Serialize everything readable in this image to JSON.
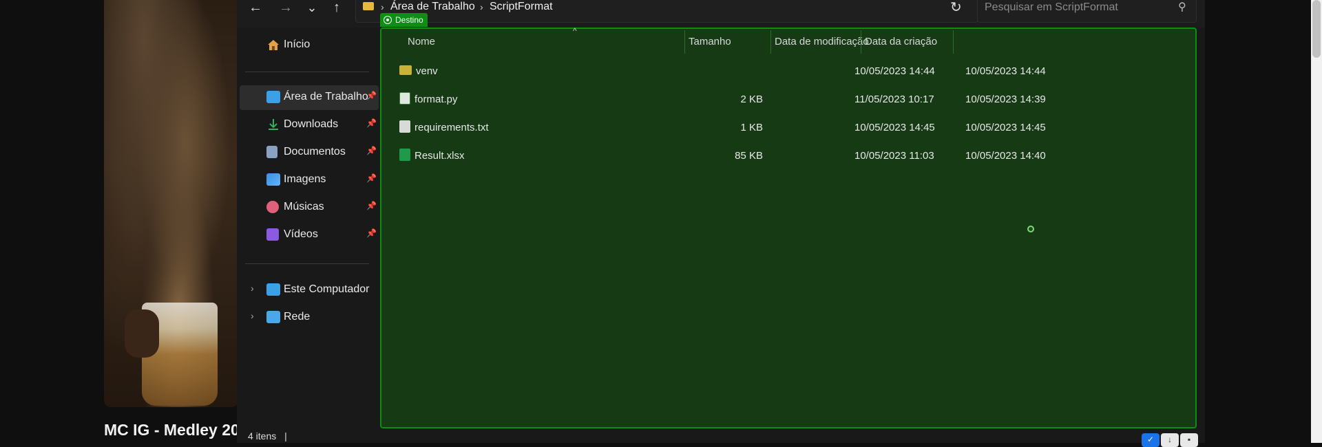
{
  "background_page": {
    "video_title": "MC IG - Medley 20"
  },
  "navbar": {
    "back_glyph": "←",
    "forward_glyph": "→",
    "recent_glyph": "⌄",
    "up_glyph": "↑",
    "breadcrumb": [
      "Área de Trabalho",
      "ScriptFormat"
    ],
    "breadcrumb_sep": "›",
    "dropdown_glyph": "⌄",
    "refresh_glyph": "↻",
    "search_placeholder": "Pesquisar em ScriptFormat",
    "search_glyph": "⚲"
  },
  "sidebar": {
    "home": "Início",
    "pinned": [
      {
        "label": "Área de Trabalho",
        "icon": "desktop-icon",
        "color": "#3ba0e6"
      },
      {
        "label": "Downloads",
        "icon": "download-icon",
        "color": "#2fb35a"
      },
      {
        "label": "Documentos",
        "icon": "documents-icon",
        "color": "#8aa2c2"
      },
      {
        "label": "Imagens",
        "icon": "pictures-icon",
        "color": "#3b8fe0"
      },
      {
        "label": "Músicas",
        "icon": "music-icon",
        "color": "#e0607a"
      },
      {
        "label": "Vídeos",
        "icon": "videos-icon",
        "color": "#8a5ae0"
      }
    ],
    "pin_glyph": "📌",
    "this_pc": "Este Computador",
    "network": "Rede",
    "expand_glyph": "›"
  },
  "drop_badge": "Destino",
  "columns": {
    "name": "Nome",
    "size": "Tamanho",
    "modified": "Data de modificação",
    "created": "Data da criação",
    "sort_glyph": "^"
  },
  "files": [
    {
      "name": "venv",
      "size": "",
      "modified": "10/05/2023 14:44",
      "created": "10/05/2023 14:44",
      "type": "folder"
    },
    {
      "name": "format.py",
      "size": "2 KB",
      "modified": "11/05/2023 10:17",
      "created": "10/05/2023 14:39",
      "type": "python"
    },
    {
      "name": "requirements.txt",
      "size": "1 KB",
      "modified": "10/05/2023 14:45",
      "created": "10/05/2023 14:45",
      "type": "text"
    },
    {
      "name": "Result.xlsx",
      "size": "85 KB",
      "modified": "10/05/2023 11:03",
      "created": "10/05/2023 14:40",
      "type": "excel"
    }
  ],
  "status": {
    "count": "4 itens",
    "sep": "|"
  },
  "colors": {
    "drop_border": "#0c8f12",
    "drop_fill": "#153a14",
    "window_bg": "#191919"
  }
}
